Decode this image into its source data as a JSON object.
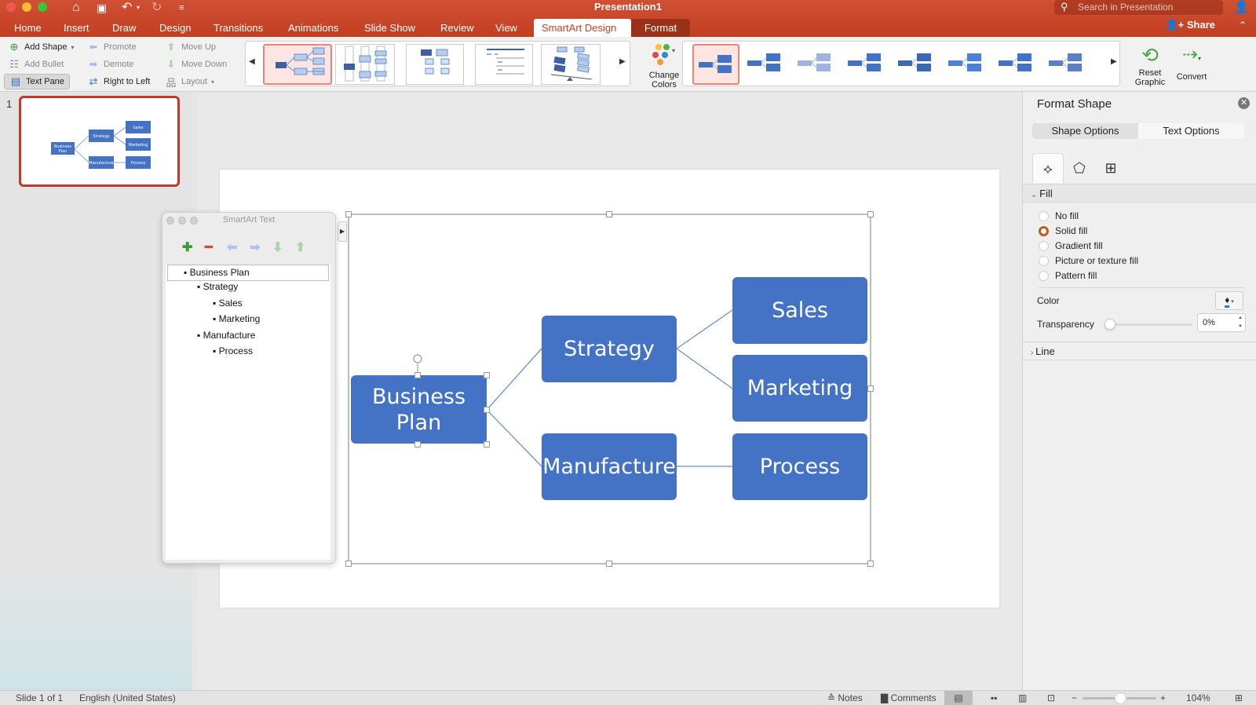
{
  "window": {
    "title": "Presentation1",
    "search_placeholder": "Search in Presentation",
    "share_label": "Share"
  },
  "tabs": [
    {
      "label": "Home"
    },
    {
      "label": "Insert"
    },
    {
      "label": "Draw"
    },
    {
      "label": "Design"
    },
    {
      "label": "Transitions"
    },
    {
      "label": "Animations"
    },
    {
      "label": "Slide Show"
    },
    {
      "label": "Review"
    },
    {
      "label": "View"
    },
    {
      "label": "SmartArt Design",
      "active": true
    },
    {
      "label": "Format"
    }
  ],
  "ribbon": {
    "add_shape": "Add Shape",
    "add_bullet": "Add Bullet",
    "text_pane": "Text Pane",
    "promote": "Promote",
    "demote": "Demote",
    "right_to_left": "Right to Left",
    "move_up": "Move Up",
    "move_down": "Move Down",
    "layout": "Layout",
    "change_colors_1": "Change",
    "change_colors_2": "Colors",
    "reset_graphic_1": "Reset",
    "reset_graphic_2": "Graphic",
    "convert": "Convert"
  },
  "slides_panel": {
    "slide_number": "1"
  },
  "smartart": {
    "root": "Business Plan",
    "root_line1": "Business",
    "root_line2": "Plan",
    "level2": [
      "Strategy",
      "Manufacture"
    ],
    "level3": [
      "Sales",
      "Marketing",
      "Process"
    ],
    "fill_color": "#4472c4"
  },
  "text_pane": {
    "title": "SmartArt Text",
    "items": [
      {
        "text": "Business Plan",
        "level": 1
      },
      {
        "text": "Strategy",
        "level": 2
      },
      {
        "text": "Sales",
        "level": 3
      },
      {
        "text": "Marketing",
        "level": 3
      },
      {
        "text": "Manufacture",
        "level": 2
      },
      {
        "text": "Process",
        "level": 3
      }
    ]
  },
  "format_pane": {
    "title": "Format Shape",
    "shape_options": "Shape Options",
    "text_options": "Text Options",
    "fill_section": "Fill",
    "fill_options": [
      "No fill",
      "Solid fill",
      "Gradient fill",
      "Picture or texture fill",
      "Pattern fill"
    ],
    "selected_fill": "Solid fill",
    "color_label": "Color",
    "transparency_label": "Transparency",
    "transparency_value": "0%",
    "line_section": "Line"
  },
  "statusbar": {
    "slide_info": "Slide 1 of 1",
    "language": "English (United States)",
    "notes": "Notes",
    "comments": "Comments",
    "zoom": "104%",
    "zoom_percent": 104
  }
}
